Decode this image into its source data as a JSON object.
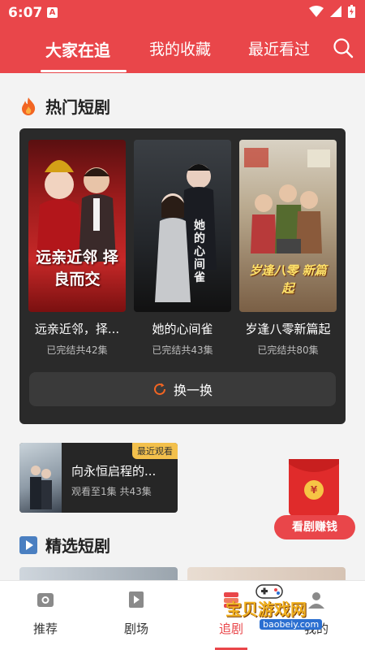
{
  "status": {
    "time": "6:07",
    "notification_glyph": "A"
  },
  "tabs": [
    {
      "label": "大家在追",
      "active": true
    },
    {
      "label": "我的收藏",
      "active": false
    },
    {
      "label": "最近看过",
      "active": false
    }
  ],
  "hot": {
    "title": "热门短剧",
    "cards": [
      {
        "name": "远亲近邻，择...",
        "eps": "已完结共42集",
        "poster_text": "远亲近邻 择良而交"
      },
      {
        "name": "她的心间雀",
        "eps": "已完结共43集",
        "poster_text": "她的心间雀"
      },
      {
        "name": "岁逢八零新篇起",
        "eps": "已完结共80集",
        "poster_text": "岁逢八零 新篇起"
      }
    ],
    "swap_label": "换一换"
  },
  "recent": {
    "badge": "最近观看",
    "title": "向永恒启程的...",
    "progress": "观看至1集 共43集"
  },
  "earn": {
    "label": "看剧赚钱",
    "coin": "¥"
  },
  "selected": {
    "title": "精选短剧"
  },
  "bottom_nav": [
    {
      "label": "推荐",
      "icon": "camera-icon",
      "active": false
    },
    {
      "label": "剧场",
      "icon": "film-icon",
      "active": false
    },
    {
      "label": "追剧",
      "icon": "stack-icon",
      "active": true
    },
    {
      "label": "我的",
      "icon": "user-icon",
      "active": false
    }
  ],
  "watermark": {
    "name": "宝贝游戏网",
    "site": "baobeiy.com"
  },
  "colors": {
    "brand": "#e9464a",
    "panel": "#2a2a2a",
    "badge": "#f3c04c"
  }
}
